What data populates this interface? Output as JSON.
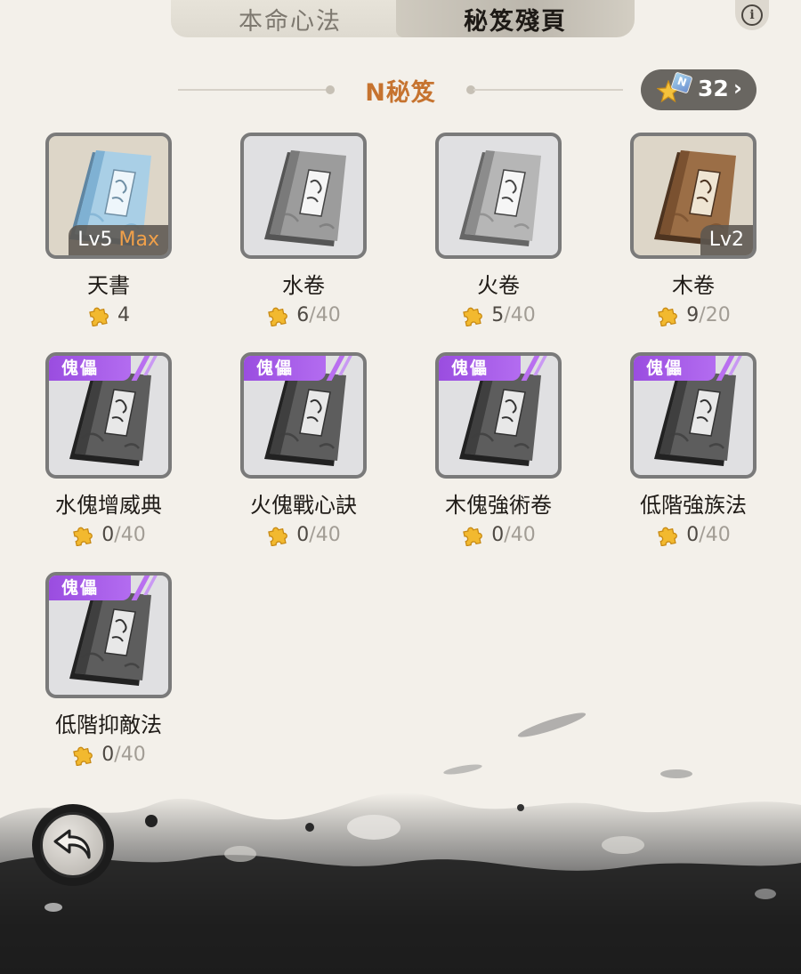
{
  "tabs": [
    {
      "label": "本命心法",
      "active": false
    },
    {
      "label": "秘笈殘頁",
      "active": true
    }
  ],
  "info_icon": "info-icon",
  "section": {
    "title": "N秘笈",
    "fragments": {
      "count": "32",
      "badge": "N",
      "icon": "puzzle-star-icon"
    }
  },
  "colors": {
    "accent": "#c6732f",
    "puppet_tag": "#a55ae8",
    "max_text": "#f0a04a"
  },
  "items": [
    {
      "name": "天書",
      "level": "Lv5",
      "level_max": "Max",
      "tag": "",
      "owned": "4",
      "total": "",
      "book": "sky"
    },
    {
      "name": "水卷",
      "level": "",
      "level_max": "",
      "tag": "",
      "owned": "6",
      "total": "/40",
      "book": "water"
    },
    {
      "name": "火卷",
      "level": "",
      "level_max": "",
      "tag": "",
      "owned": "5",
      "total": "/40",
      "book": "fire"
    },
    {
      "name": "木卷",
      "level": "Lv2",
      "level_max": "",
      "tag": "",
      "owned": "9",
      "total": "/20",
      "book": "wood"
    },
    {
      "name": "水傀增威典",
      "level": "",
      "level_max": "",
      "tag": "傀儡",
      "owned": "0",
      "total": "/40",
      "book": "dark"
    },
    {
      "name": "火傀戰心訣",
      "level": "",
      "level_max": "",
      "tag": "傀儡",
      "owned": "0",
      "total": "/40",
      "book": "dark"
    },
    {
      "name": "木傀強術卷",
      "level": "",
      "level_max": "",
      "tag": "傀儡",
      "owned": "0",
      "total": "/40",
      "book": "dark"
    },
    {
      "name": "低階強族法",
      "level": "",
      "level_max": "",
      "tag": "傀儡",
      "owned": "0",
      "total": "/40",
      "book": "dark"
    },
    {
      "name": "低階抑敵法",
      "level": "",
      "level_max": "",
      "tag": "傀儡",
      "owned": "0",
      "total": "/40",
      "book": "dark"
    }
  ],
  "back_button": {
    "icon": "return-arrow-icon"
  }
}
